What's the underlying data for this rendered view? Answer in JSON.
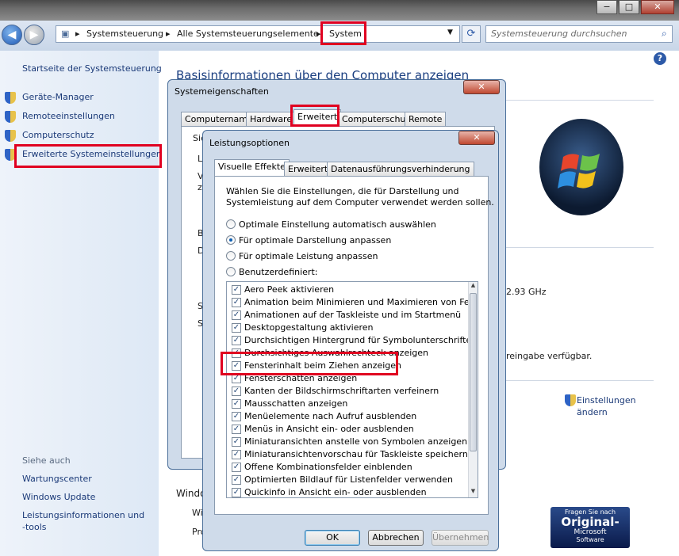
{
  "window": {
    "min_icon": "−",
    "max_icon": "□",
    "close_icon": "✕"
  },
  "nav": {
    "back": "◀",
    "forward": "▶",
    "breadcrumb": [
      "Systemsteuerung",
      "Alle Systemsteuerungselemente",
      "System"
    ],
    "search_placeholder": "Systemsteuerung durchsuchen"
  },
  "sidebar": {
    "home": "Startseite der Systemsteuerung",
    "items": [
      {
        "label": "Geräte-Manager",
        "icon": "shield-icon"
      },
      {
        "label": "Remoteeinstellungen",
        "icon": "shield-icon"
      },
      {
        "label": "Computerschutz",
        "icon": "shield-icon"
      },
      {
        "label": "Erweiterte Systemeinstellungen",
        "icon": "shield-icon"
      }
    ],
    "see_also_heading": "Siehe auch",
    "see_also": [
      "Wartungscenter",
      "Windows Update",
      "Leistungsinformationen und",
      "-tools"
    ]
  },
  "main": {
    "heading": "Basisinformationen über den Computer anzeigen",
    "ghz": "2.93 GHz",
    "freigabe": "reingabe verfügbar.",
    "settings_link1": "Einstellungen",
    "settings_link2": "ändern",
    "windo": "Windo",
    "wi": "Wi",
    "pro": "Pro",
    "badge1": "Fragen Sie nach",
    "badge2": "Original-",
    "badge3": "Microsoft",
    "badge4": "Software"
  },
  "sysprops": {
    "title": "Systemeigenschaften",
    "tabs": [
      "Computername",
      "Hardware",
      "Erweitert",
      "Computerschutz",
      "Remote"
    ],
    "active_tab": "Erweitert",
    "frag": [
      "Sie",
      "L",
      "V",
      "z",
      "B",
      "D",
      "S",
      "S"
    ]
  },
  "perf": {
    "title": "Leistungsoptionen",
    "tabs": [
      "Visuelle Effekte",
      "Erweitert",
      "Datenausführungsverhinderung"
    ],
    "active_tab": "Visuelle Effekte",
    "intro1": "Wählen Sie die Einstellungen, die für Darstellung und",
    "intro2": "Systemleistung auf dem Computer verwendet werden sollen.",
    "radios": [
      {
        "label": "Optimale Einstellung automatisch auswählen",
        "selected": false
      },
      {
        "label": "Für optimale Darstellung anpassen",
        "selected": true
      },
      {
        "label": "Für optimale Leistung anpassen",
        "selected": false
      },
      {
        "label": "Benutzerdefiniert:",
        "selected": false
      }
    ],
    "options": [
      "Aero Peek aktivieren",
      "Animation beim Minimieren und Maximieren von Fenstern",
      "Animationen auf der Taskleiste und im Startmenü",
      "Desktopgestaltung aktivieren",
      "Durchsichtigen Hintergrund für Symbolunterschriften auf d",
      "Durchsichtiges Auswahlrechteck anzeigen",
      "Fensterinhalt beim Ziehen anzeigen",
      "Fensterschatten anzeigen",
      "Kanten der Bildschirmschriftarten verfeinern",
      "Mausschatten anzeigen",
      "Menüelemente nach Aufruf ausblenden",
      "Menüs in Ansicht ein- oder ausblenden",
      "Miniaturansichten anstelle von Symbolen anzeigen",
      "Miniaturansichtenvorschau für Taskleiste speichern",
      "Offene Kombinationsfelder einblenden",
      "Optimierten Bildlauf für Listenfelder verwenden",
      "Quickinfo in Ansicht ein- oder ausblenden"
    ],
    "check": "✓",
    "ok": "OK",
    "cancel": "Abbrechen",
    "apply": "Übernehmen",
    "close": "✕"
  }
}
